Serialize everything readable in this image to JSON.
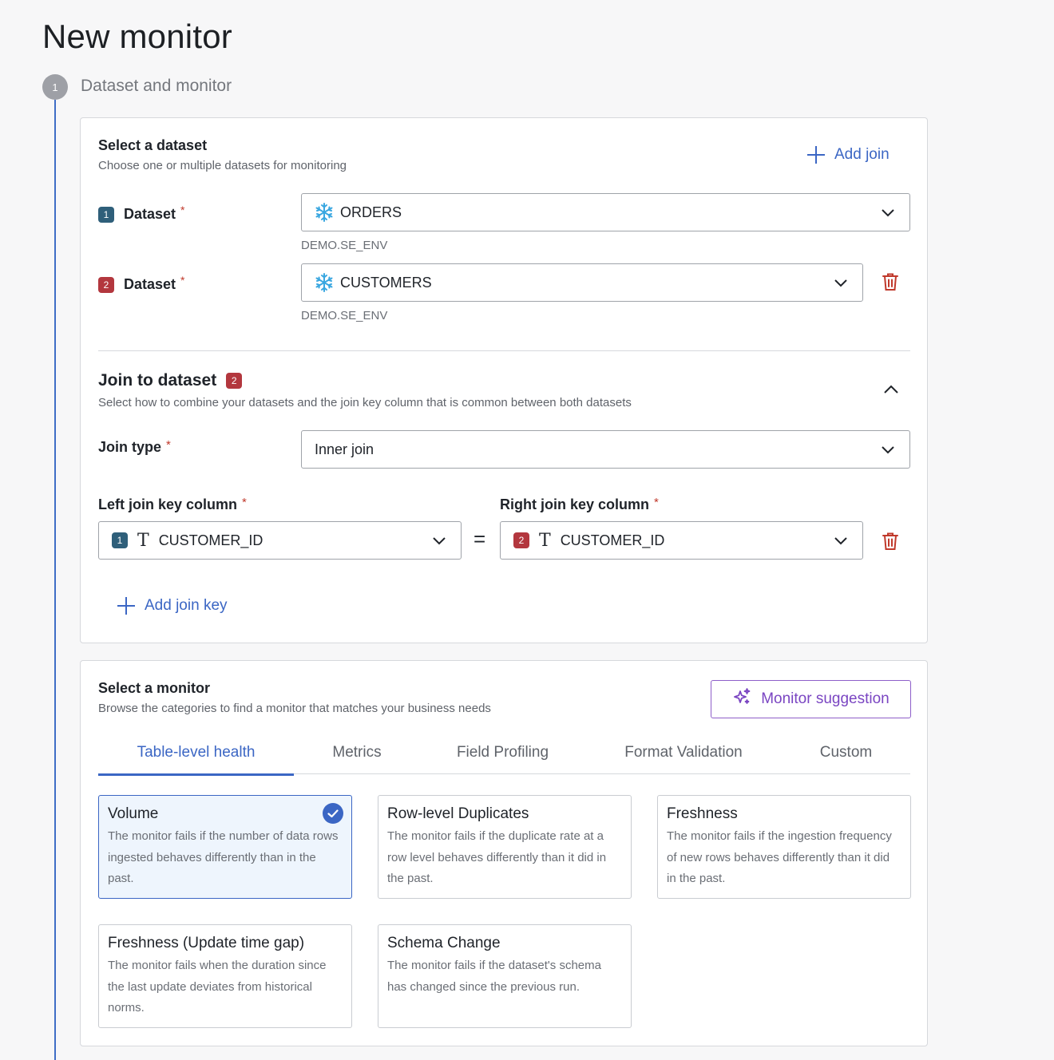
{
  "page": {
    "title": "New monitor"
  },
  "step": {
    "number": "1",
    "title": "Dataset and monitor"
  },
  "dataset_section": {
    "title": "Select a dataset",
    "subtitle": "Choose one or multiple datasets for monitoring",
    "add_join_label": "Add join",
    "datasets": [
      {
        "badge": "1",
        "label": "Dataset",
        "required": "*",
        "value": "ORDERS",
        "help": "DEMO.SE_ENV",
        "icon": "snowflake-icon"
      },
      {
        "badge": "2",
        "label": "Dataset",
        "required": "*",
        "value": "CUSTOMERS",
        "help": "DEMO.SE_ENV",
        "icon": "snowflake-icon"
      }
    ]
  },
  "join_section": {
    "title": "Join to dataset",
    "badge": "2",
    "subtitle": "Select how to combine your datasets and the join key column that is common between both datasets",
    "join_type": {
      "label": "Join type",
      "required": "*",
      "value": "Inner join"
    },
    "left_key": {
      "label": "Left join key column",
      "required": "*",
      "badge": "1",
      "value": "CUSTOMER_ID"
    },
    "right_key": {
      "label": "Right join key column",
      "required": "*",
      "badge": "2",
      "value": "CUSTOMER_ID"
    },
    "equals": "=",
    "add_join_key_label": "Add join key"
  },
  "monitor_section": {
    "title": "Select a monitor",
    "subtitle": "Browse the categories to find a monitor that matches your business needs",
    "suggestion_label": "Monitor suggestion",
    "tabs": [
      "Table-level health",
      "Metrics",
      "Field Profiling",
      "Format Validation",
      "Custom"
    ],
    "active_tab": "Table-level health",
    "cards": [
      {
        "title": "Volume",
        "desc": "The monitor fails if the number of data rows ingested behaves differently than in the past.",
        "selected": true
      },
      {
        "title": "Row-level Duplicates",
        "desc": "The monitor fails if the duplicate rate at a row level behaves differently than it did in the past.",
        "selected": false
      },
      {
        "title": "Freshness",
        "desc": "The monitor fails if the ingestion frequency of new rows behaves differently than it did in the past.",
        "selected": false
      },
      {
        "title": "Freshness (Update time gap)",
        "desc": "The monitor fails when the duration since the last update deviates from historical norms.",
        "selected": false
      },
      {
        "title": "Schema Change",
        "desc": "The monitor fails if the dataset's schema has changed since the previous run.",
        "selected": false
      }
    ]
  },
  "colors": {
    "accent": "#3b66c4",
    "danger": "#c0392b",
    "badge_1": "#2f5f7a",
    "badge_2": "#b3373e",
    "suggestion": "#7a45c2",
    "selected_card_bg": "#eef5fd",
    "snowflake": "#3aa7e0"
  }
}
